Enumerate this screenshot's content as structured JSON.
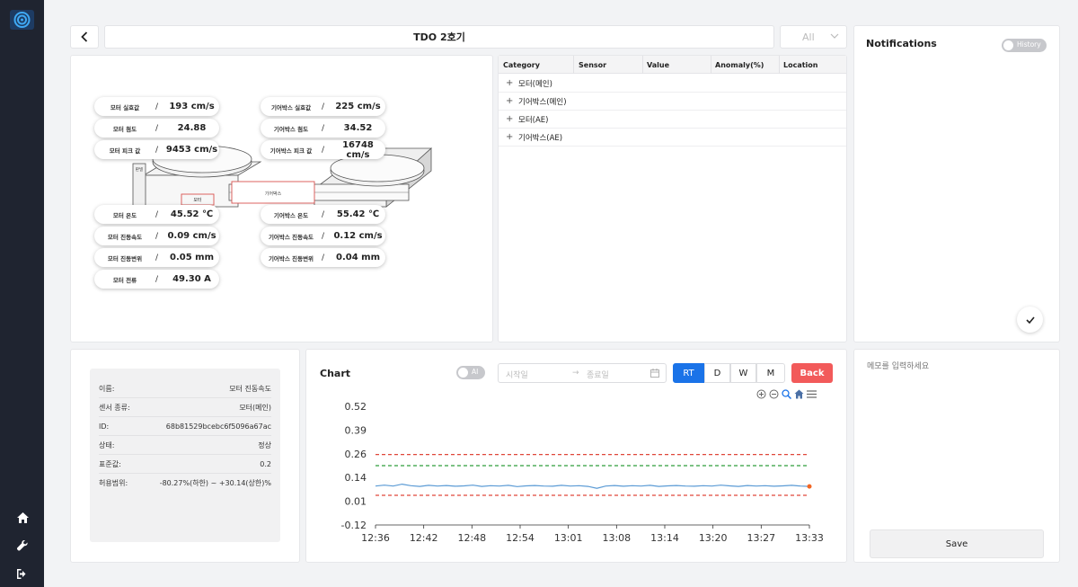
{
  "header": {
    "title": "TDO 2호기",
    "filter_value": "All"
  },
  "diagram": {
    "motor_label": "모터",
    "gearbox_label": "기어박스",
    "panel_label": "판넬",
    "left_pills": [
      {
        "label": "모터 실효값",
        "value": "193 cm/s"
      },
      {
        "label": "모터 첨도",
        "value": "24.88"
      },
      {
        "label": "모터 피크 값",
        "value": "9453 cm/s"
      },
      {
        "label": "모터 온도",
        "value": "45.52 ℃"
      },
      {
        "label": "모터 진동속도",
        "value": "0.09 cm/s"
      },
      {
        "label": "모터 진동변위",
        "value": "0.05 mm"
      },
      {
        "label": "모터 전류",
        "value": "49.30 A"
      }
    ],
    "right_pills": [
      {
        "label": "기어박스 실효값",
        "value": "225 cm/s"
      },
      {
        "label": "기어박스 첨도",
        "value": "34.52"
      },
      {
        "label": "기어박스 피크 값",
        "value": "16748 cm/s"
      },
      {
        "label": "기어박스 온도",
        "value": "55.42 ℃"
      },
      {
        "label": "기어박스 진동속도",
        "value": "0.12 cm/s"
      },
      {
        "label": "기어박스 진동변위",
        "value": "0.04 mm"
      }
    ],
    "separator": "/"
  },
  "table": {
    "columns": [
      "Category",
      "Sensor",
      "Value",
      "Anomaly(%)",
      "Location"
    ],
    "rows": [
      "모터(메인)",
      "기어박스(메인)",
      "모터(AE)",
      "기어박스(AE)"
    ]
  },
  "notifications": {
    "title": "Notifications",
    "history_label": "History"
  },
  "info": {
    "rows": [
      {
        "key": "이름:",
        "value": "모터 진동속도"
      },
      {
        "key": "센서 종류:",
        "value": "모터(메인)"
      },
      {
        "key": "ID:",
        "value": "68b81529bcebc6f5096a67ac"
      },
      {
        "key": "상태:",
        "value": "정상"
      },
      {
        "key": "표준값:",
        "value": "0.2"
      },
      {
        "key": "허용범위:",
        "value": "-80.27%(하한) ~ +30.14(상한)%"
      }
    ]
  },
  "chart_panel": {
    "title": "Chart",
    "ai_label": "AI",
    "start_placeholder": "시작일",
    "end_placeholder": "종료일",
    "arrow": "→",
    "ranges": [
      "RT",
      "D",
      "W",
      "M"
    ],
    "active_range": "RT",
    "back_label": "Back"
  },
  "chart_data": {
    "type": "line",
    "x_ticks": [
      "12:36",
      "12:42",
      "12:48",
      "12:54",
      "13:01",
      "13:08",
      "13:14",
      "13:20",
      "13:27",
      "13:33"
    ],
    "y_ticks": [
      "0.52",
      "0.39",
      "0.26",
      "0.14",
      "0.01",
      "-0.12"
    ],
    "ylim": [
      -0.12,
      0.52
    ],
    "thresholds": {
      "upper_red": 0.26,
      "upper_green": 0.2,
      "lower_red": 0.04
    },
    "series": [
      {
        "values": [
          0.09,
          0.095,
          0.09,
          0.1,
          0.092,
          0.088,
          0.094,
          0.09,
          0.093,
          0.089,
          0.091,
          0.095,
          0.088,
          0.092,
          0.09,
          0.094,
          0.087,
          0.091,
          0.093,
          0.09,
          0.089,
          0.094,
          0.09,
          0.092,
          0.088,
          0.078,
          0.09,
          0.093,
          0.089,
          0.092,
          0.09,
          0.094,
          0.088,
          0.091,
          0.093,
          0.09,
          0.089,
          0.092,
          0.09,
          0.095,
          0.091,
          0.088,
          0.093,
          0.09,
          0.092,
          0.089,
          0.091,
          0.094,
          0.09,
          0.088
        ]
      }
    ],
    "colors": {
      "line": "#5b9bd5",
      "red": "#e0473a",
      "green": "#2e9d3a",
      "end_marker": "#f26522"
    }
  },
  "memo": {
    "placeholder": "메모를 입력하세요",
    "save_label": "Save"
  }
}
